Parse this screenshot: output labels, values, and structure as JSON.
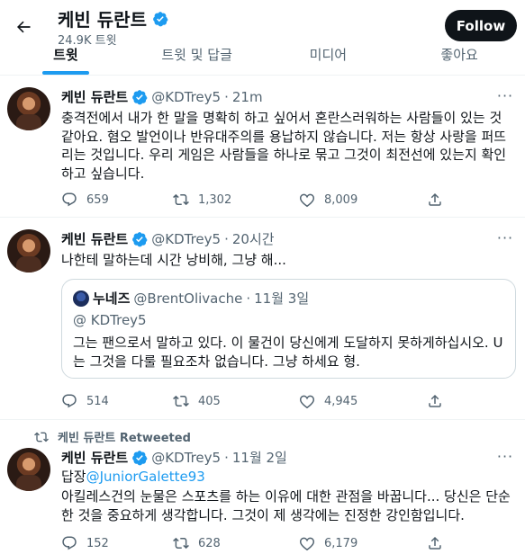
{
  "header": {
    "title": "케빈 듀란트",
    "tweet_count": "24.9K 트윗",
    "follow_label": "Follow"
  },
  "tabs": [
    {
      "label": "트윗",
      "active": true
    },
    {
      "label": "트윗 및 답글",
      "active": false
    },
    {
      "label": "미디어",
      "active": false
    },
    {
      "label": "좋아요",
      "active": false
    }
  ],
  "colors": {
    "accent": "#1d9bf0",
    "text": "#0f1419",
    "muted": "#536471",
    "border": "#eff3f4"
  },
  "tweets": [
    {
      "name": "케빈 듀란트",
      "handle": "@KDTrey5",
      "time": "21m",
      "text": "충격전에서 내가 한 말을 명확히 하고 싶어서 혼란스러워하는 사람들이 있는 것 같아요. 혐오 발언이나 반유대주의를 용납하지 않습니다. 저는 항상 사랑을 퍼뜨리는 것입니다. 우리 게임은 사람들을 하나로 묶고 그것이 최전선에 있는지 확인하고 싶습니다.",
      "replies": "659",
      "retweets": "1,302",
      "likes": "8,009"
    },
    {
      "name": "케빈 듀란트",
      "handle": "@KDTrey5",
      "time": "20시간",
      "text": "나한테 말하는데 시간 낭비해, 그냥 해...",
      "quote": {
        "name": "누네즈",
        "handle": "@BrentOlivache",
        "date": "11월 3일",
        "reply_to": "@ KDTrey5",
        "text": "그는 팬으로서 말하고 있다. 이 물건이 당신에게 도달하지 못하게하십시오. U는 그것을 다룰 필요조차 없습니다. 그냥 하세요 형."
      },
      "replies": "514",
      "retweets": "405",
      "likes": "4,945"
    },
    {
      "retweeted_by": "케빈 듀란트 Retweeted",
      "name": "케빈 듀란트",
      "handle": "@KDTrey5",
      "time": "11월 2일",
      "reply_prefix": "답장",
      "reply_handle": "@JuniorGalette93",
      "text": "아킬레스건의 눈물은 스포츠를 하는 이유에 대한 관점을 바꿉니다... 당신은 단순한 것을 중요하게 생각합니다. 그것이 제 생각에는 진정한 강인함입니다.",
      "replies": "152",
      "retweets": "628",
      "likes": "6,179"
    }
  ],
  "icons": {
    "back": "back-arrow-icon",
    "verified": "verified-badge-icon",
    "more": "more-dots-icon",
    "reply": "reply-icon",
    "retweet": "retweet-icon",
    "like": "heart-icon",
    "share": "share-icon"
  }
}
